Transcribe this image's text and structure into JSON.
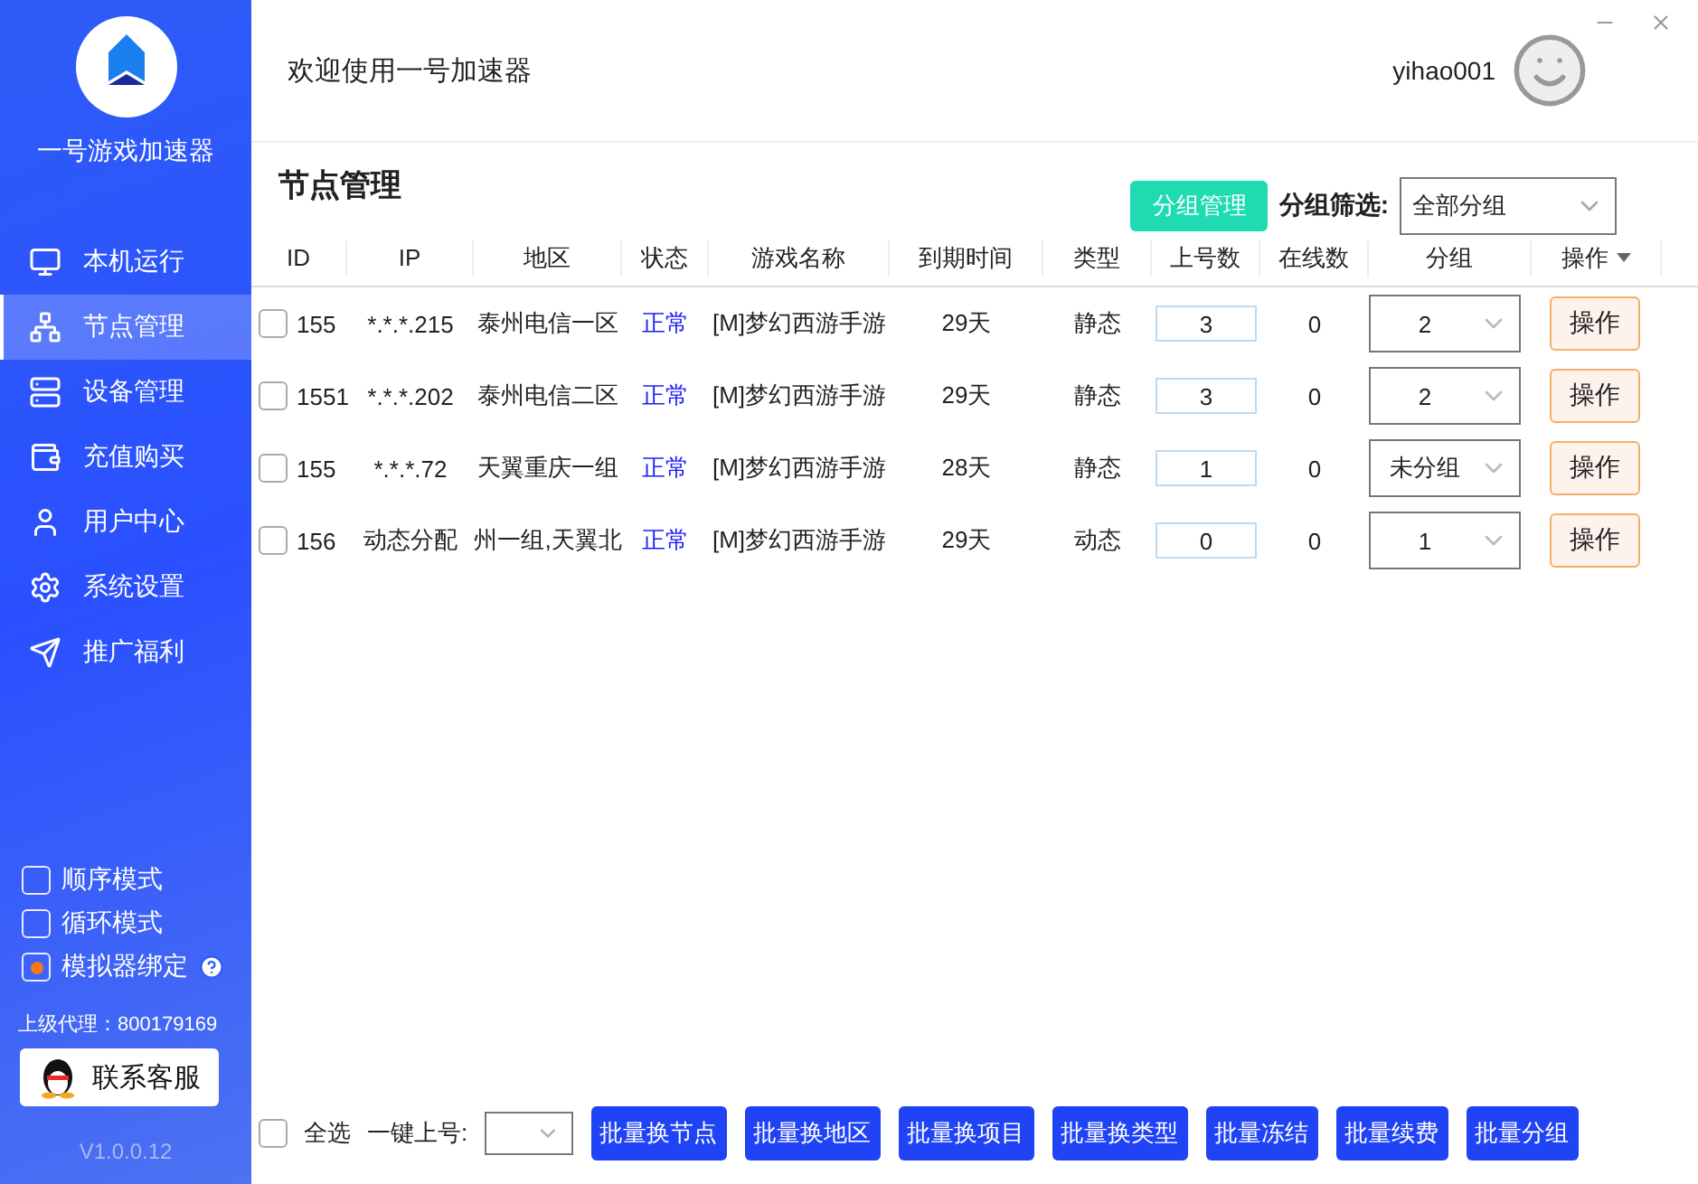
{
  "app": {
    "name": "一号游戏加速器",
    "version": "V1.0.0.12"
  },
  "sidebar": {
    "items": [
      {
        "label": "本机运行",
        "selected": false
      },
      {
        "label": "节点管理",
        "selected": true
      },
      {
        "label": "设备管理",
        "selected": false
      },
      {
        "label": "充值购买",
        "selected": false
      },
      {
        "label": "用户中心",
        "selected": false
      },
      {
        "label": "系统设置",
        "selected": false
      },
      {
        "label": "推广福利",
        "selected": false
      }
    ],
    "options": [
      {
        "label": "顺序模式",
        "checked": false,
        "help": false
      },
      {
        "label": "循环模式",
        "checked": false,
        "help": false
      },
      {
        "label": "模拟器绑定",
        "checked": true,
        "help": true
      }
    ],
    "agent": "上级代理：800179169",
    "contact_button": "联系客服"
  },
  "header": {
    "welcome": "欢迎使用一号加速器",
    "username": "yihao001"
  },
  "page": {
    "title": "节点管理",
    "group_manage_button": "分组管理",
    "filter_label": "分组筛选:",
    "filter_value": "全部分组"
  },
  "table": {
    "columns": [
      "ID",
      "IP",
      "地区",
      "状态",
      "游戏名称",
      "到期时间",
      "类型",
      "上号数",
      "在线数",
      "分组",
      "操作"
    ],
    "rows": [
      {
        "checked": false,
        "id": "155",
        "ip": "*.*.*.215",
        "region": "泰州电信一区",
        "status": "正常",
        "game": "[M]梦幻西游手游",
        "expires": "29天",
        "type": "静态",
        "logins": "3",
        "online": "0",
        "group": "2",
        "action": "操作"
      },
      {
        "checked": false,
        "id": "1551",
        "ip": "*.*.*.202",
        "region": "泰州电信二区",
        "status": "正常",
        "game": "[M]梦幻西游手游",
        "expires": "29天",
        "type": "静态",
        "logins": "3",
        "online": "0",
        "group": "2",
        "action": "操作"
      },
      {
        "checked": false,
        "id": "155",
        "ip": "*.*.*.72",
        "region": "天翼重庆一组",
        "status": "正常",
        "game": "[M]梦幻西游手游",
        "expires": "28天",
        "type": "静态",
        "logins": "1",
        "online": "0",
        "group": "未分组",
        "action": "操作"
      },
      {
        "checked": false,
        "id": "156",
        "ip": "动态分配",
        "region": "州一组,天翼北",
        "status": "正常",
        "game": "[M]梦幻西游手游",
        "expires": "29天",
        "type": "动态",
        "logins": "0",
        "online": "0",
        "group": "1",
        "action": "操作"
      }
    ]
  },
  "footer": {
    "select_all": {
      "label": "全选",
      "checked": false
    },
    "quick_login_label": "一键上号:",
    "buttons": [
      "批量换节点",
      "批量换地区",
      "批量换项目",
      "批量换类型",
      "批量冻结",
      "批量续费",
      "批量分组"
    ]
  }
}
